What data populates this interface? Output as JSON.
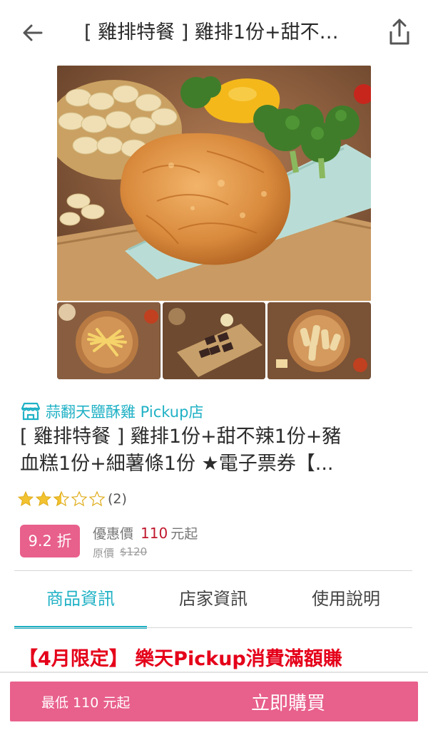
{
  "header": {
    "title": "[ 雞排特餐 ] 雞排1份+甜不辣1份+豬血糕1份+細薯條1份 ★電子票券【...",
    "back_icon": "arrow-left-icon",
    "share_icon": "share-icon"
  },
  "store": {
    "icon": "store-icon",
    "name": "蒜翻天鹽酥雞 Pickup店"
  },
  "product": {
    "title_line1": "[ 雞排特餐 ] 雞排1份+甜不辣1份+豬",
    "title_line2": "血糕1份+細薯條1份 ★電子票券【..."
  },
  "rating": {
    "score_stars": 2.5,
    "max_stars": 5,
    "count": "(2)",
    "star_color": "#f2c230"
  },
  "price": {
    "discount_badge": "9.2 折",
    "sale_label": "優惠價",
    "sale_value": "110",
    "sale_unit": "元起",
    "orig_label": "原價",
    "orig_value": "$120"
  },
  "tabs": [
    {
      "label": "商品資訊",
      "active": true
    },
    {
      "label": "店家資訊",
      "active": false
    },
    {
      "label": "使用說明",
      "active": false
    }
  ],
  "promo": {
    "text": "【4月限定】 樂天Pickup消費滿額賺"
  },
  "buy_bar": {
    "min_price": "最低 110 元起",
    "buy_label": "立即購買"
  },
  "colors": {
    "accent": "#1fb1c5",
    "pink": "#e8608c",
    "price_red": "#c0172c",
    "promo_red": "#e5001a"
  }
}
